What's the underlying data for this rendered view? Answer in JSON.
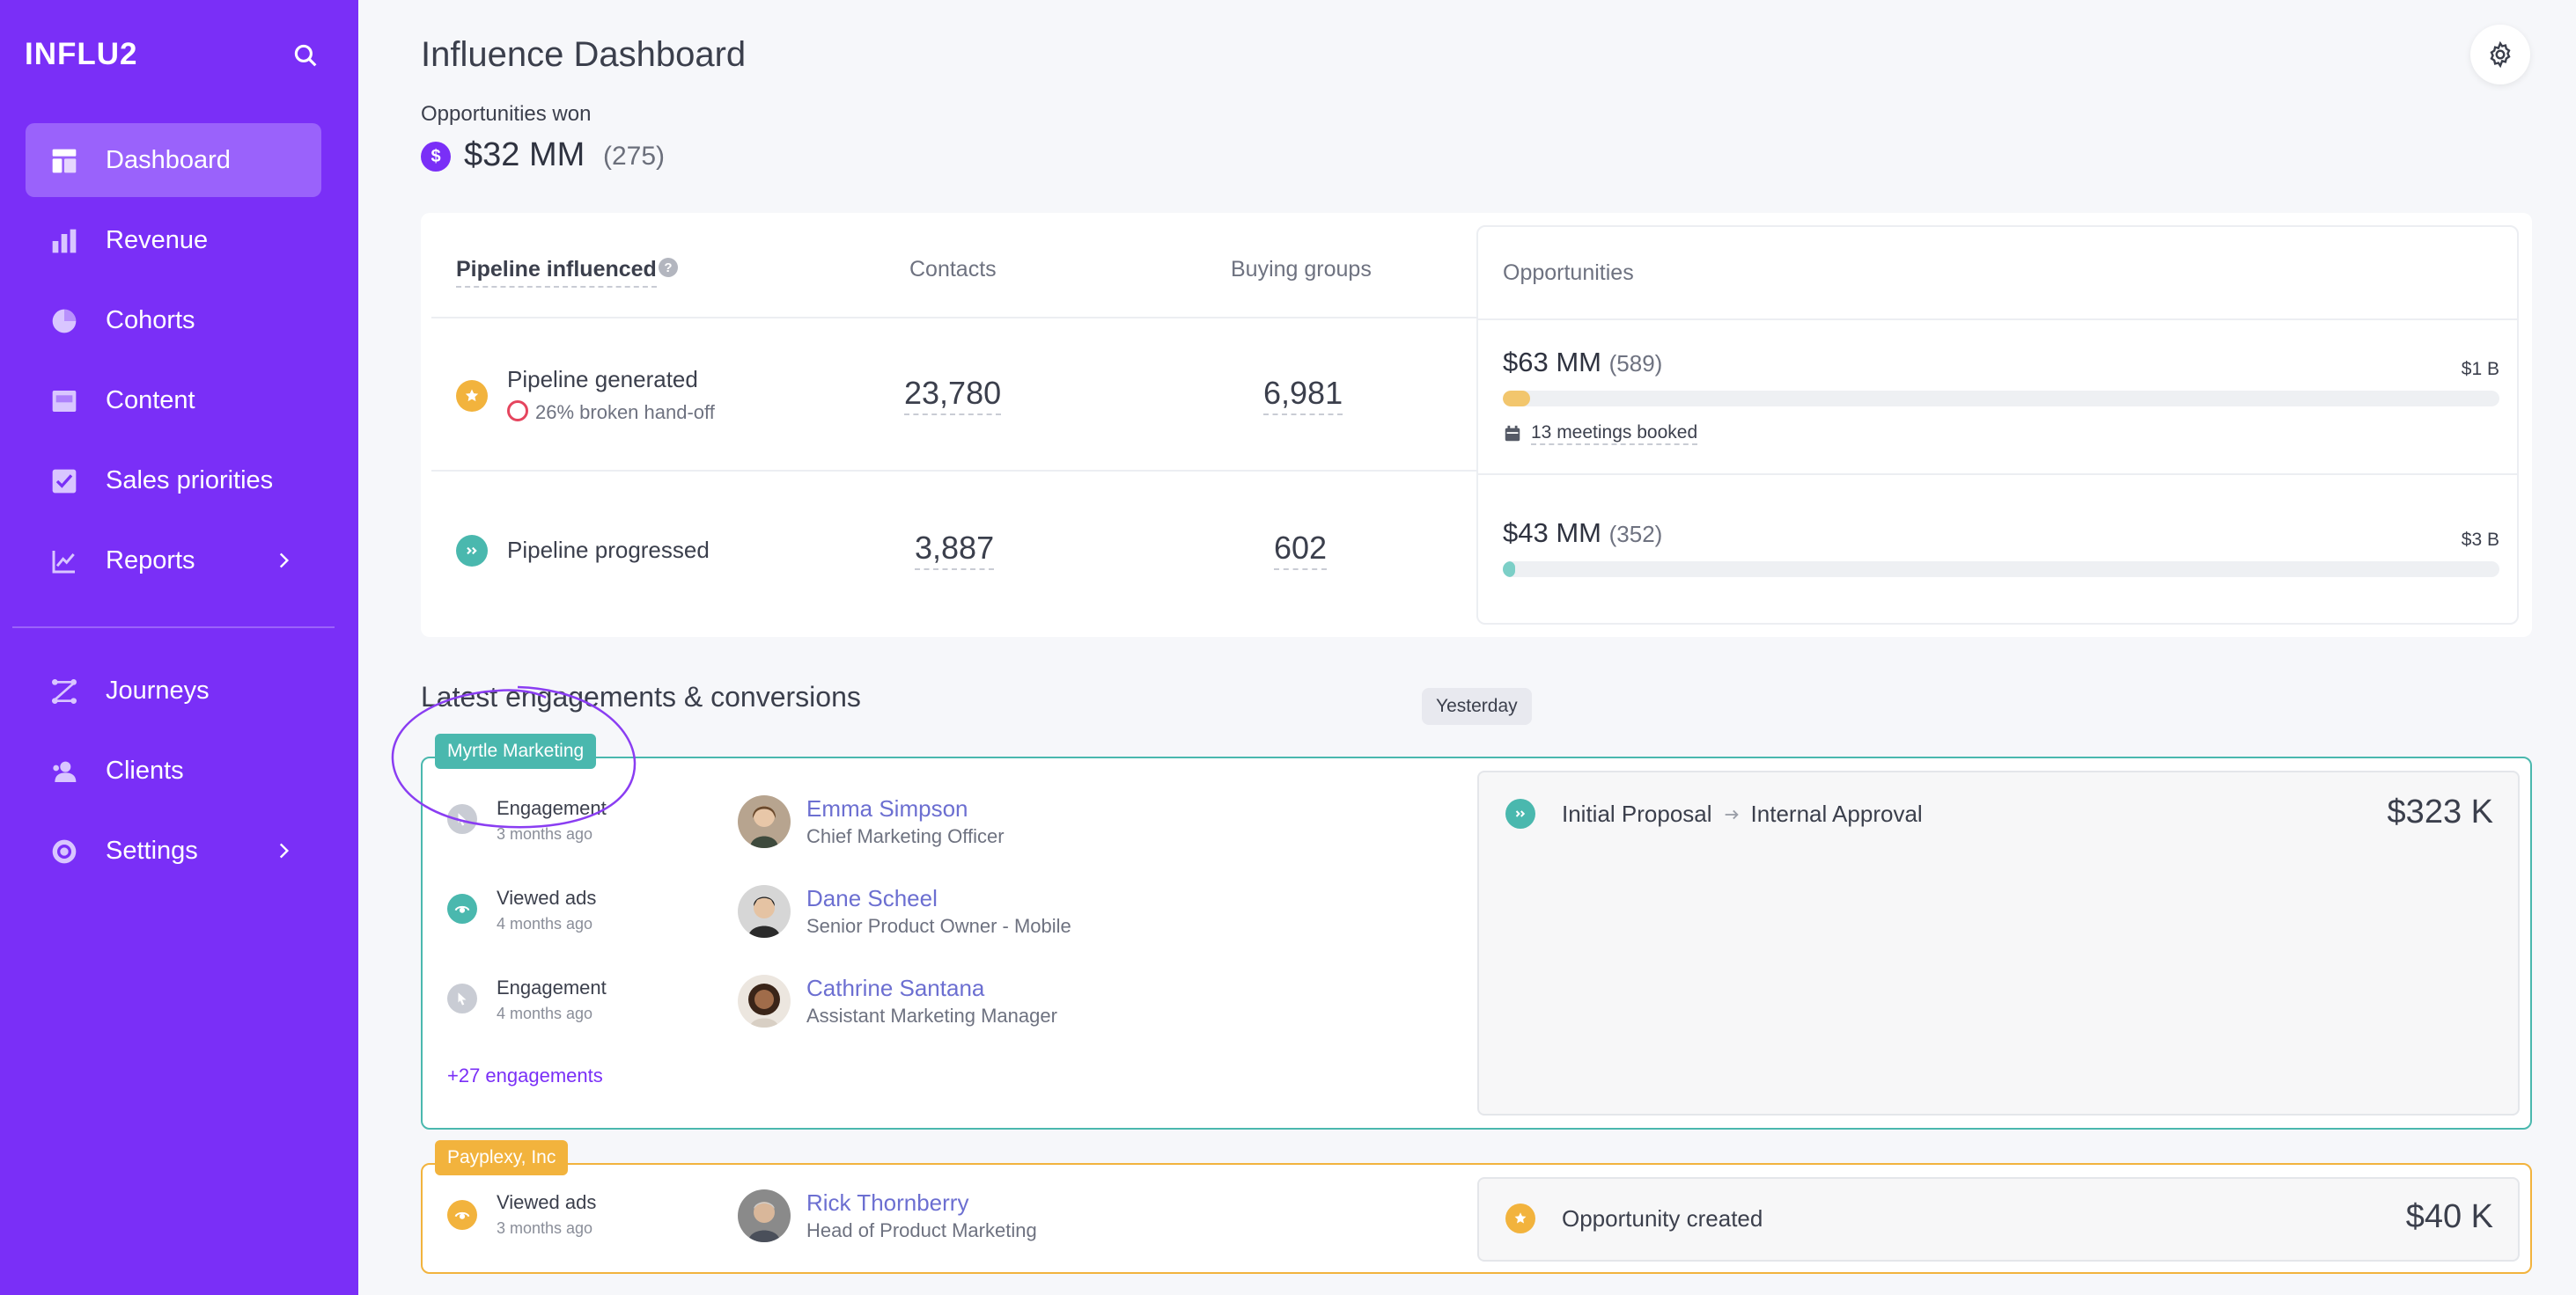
{
  "app": {
    "logo": "INFLU2"
  },
  "sidebar": {
    "items": [
      {
        "label": "Dashboard",
        "icon": "dashboard-icon",
        "active": true
      },
      {
        "label": "Revenue",
        "icon": "bar-chart-icon"
      },
      {
        "label": "Cohorts",
        "icon": "pie-chart-icon"
      },
      {
        "label": "Content",
        "icon": "content-icon"
      },
      {
        "label": "Sales priorities",
        "icon": "checkbox-icon"
      },
      {
        "label": "Reports",
        "icon": "line-chart-icon",
        "has_submenu": true
      },
      {
        "label": "Journeys",
        "icon": "journeys-icon"
      },
      {
        "label": "Clients",
        "icon": "clients-icon"
      },
      {
        "label": "Settings",
        "icon": "settings-icon",
        "has_submenu": true
      }
    ]
  },
  "header": {
    "title": "Influence Dashboard",
    "won_label": "Opportunities won",
    "won_icon": "$",
    "won_value": "$32 MM",
    "won_count": "(275)"
  },
  "pipeline": {
    "label": "Pipeline influenced",
    "help": "?",
    "columns": {
      "contacts": "Contacts",
      "buying_groups": "Buying groups",
      "opportunities": "Opportunities"
    },
    "rows": [
      {
        "title": "Pipeline generated",
        "sub": "26% broken hand-off",
        "contacts": "23,780",
        "buying_groups": "6,981",
        "opp_value": "$63 MM",
        "opp_count": "(589)",
        "opp_max": "$1 B",
        "progress": 0.027,
        "meetings": "13 meetings booked",
        "color": "#f2b33d"
      },
      {
        "title": "Pipeline progressed",
        "contacts": "3,887",
        "buying_groups": "602",
        "opp_value": "$43 MM",
        "opp_count": "(352)",
        "opp_max": "$3 B",
        "progress": 0.012,
        "color": "#4ab8ae"
      }
    ]
  },
  "engagements": {
    "title": "Latest engagements & conversions",
    "date_label": "Yesterday",
    "cards": [
      {
        "company": "Myrtle Marketing",
        "color": "#4ab8ae",
        "activities": [
          {
            "title": "Engagement",
            "time": "3 months ago",
            "name": "Emma Simpson",
            "role": "Chief Marketing Officer"
          },
          {
            "title": "Viewed ads",
            "time": "4 months ago",
            "name": "Dane Scheel",
            "role": "Senior Product Owner - Mobile"
          },
          {
            "title": "Engagement",
            "time": "4 months ago",
            "name": "Cathrine Santana",
            "role": "Assistant Marketing Manager"
          }
        ],
        "more": "+27 engagements",
        "stage_from": "Initial Proposal",
        "stage_to": "Internal Approval",
        "amount": "$323 K"
      },
      {
        "company": "Payplexy, Inc",
        "color": "#f2b33d",
        "activities": [
          {
            "title": "Viewed ads",
            "time": "3 months ago",
            "name": "Rick Thornberry",
            "role": "Head of Product Marketing"
          }
        ],
        "stage": "Opportunity created",
        "amount": "$40 K"
      }
    ]
  },
  "colors": {
    "brand": "#7a2ff7",
    "teal": "#4ab8ae",
    "orange": "#f2b33d",
    "link": "#6c6fd1"
  }
}
